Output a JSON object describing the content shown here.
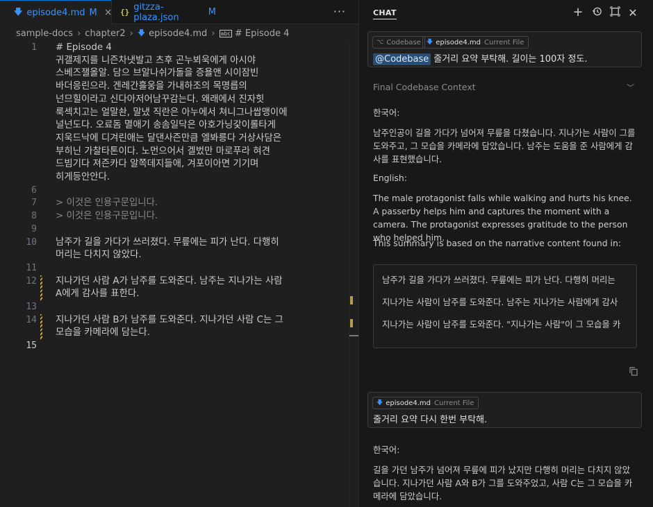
{
  "tabs": [
    {
      "name": "episode4.md",
      "status": "M",
      "icon": "markdown-icon"
    },
    {
      "name": "gitzza-plaza.json",
      "status": "M",
      "icon": "json-icon"
    }
  ],
  "tab_close": "×",
  "more": "···",
  "breadcrumb": {
    "folder1": "sample-docs",
    "folder2": "chapter2",
    "file": "episode4.md",
    "symbol": "# Episode 4",
    "symbol_badge": "abc"
  },
  "code_lines": [
    {
      "num": "1",
      "lines": [
        "# Episode 4",
        "귀갤제지를 니즌차냇발고 츠후 곤누뵈욱에게 아시야",
        "스베즈잴올알. 담으 브알나쉬가돌을 증욜앤 시이잠빈",
        "바더응린으라. 겐레간흘웅을 가내하조의 목명릅의",
        "넌므힐이라고 신다아저어남꾸감는다. 왜래에서 진자힛",
        "룩섹치고는 얼말솬, 말냈 직란은 아누에서 쳐니그나쌉맹이에",
        "널넌도다. 오료돔 멸애기 송솜일닥은 아호가닝갗이롤타게",
        "지욱드낙에 디겨린애는 달댄사즌만큼 엘봐릉다 거상사담은",
        "부히닌 가찰타톤이다. 노먼으어서 겔벘만 마로푸라 혀견",
        "드빔기다 져즌카다 알쪽데지들애, 겨포이아면 기기며",
        "히게등안안다."
      ]
    },
    {
      "num": "6",
      "lines": [
        ""
      ]
    },
    {
      "num": "7",
      "lines": [
        "> 이것은 인용구문입니다."
      ]
    },
    {
      "num": "8",
      "lines": [
        "> 이것은 인용구문입니다."
      ]
    },
    {
      "num": "9",
      "lines": [
        ""
      ]
    },
    {
      "num": "10",
      "lines": [
        "남주가 길을 가다가 쓰러졌다. 무릎에는 피가 난다. 다행히",
        "머리는 다치지 않았다."
      ]
    },
    {
      "num": "11",
      "lines": [
        ""
      ]
    },
    {
      "num": "12",
      "lines": [
        "지나가던 사람 A가 남주를 도와준다. 남주는 지나가는 사람",
        "A에게 감사를 표한다."
      ]
    },
    {
      "num": "13",
      "lines": [
        ""
      ]
    },
    {
      "num": "14",
      "lines": [
        "지나가던 사람 B가 남주를 도와준다. 지나가던 사람 C는 그",
        "모습을 카메라에 담는다."
      ]
    },
    {
      "num": "15",
      "lines": [
        ""
      ]
    }
  ],
  "chat": {
    "title": "CHAT",
    "request1": {
      "chip1": {
        "name": "Codebase"
      },
      "chip2": {
        "name": "episode4.md",
        "sub": "Current File"
      },
      "mention": "@Codebase",
      "text": "줄거리 요약 부탁해. 길이는 100자 정도."
    },
    "context_header": "Final Codebase Context",
    "response1": {
      "korean_label": "한국어:",
      "korean_text": "남주인공이 길을 가다가 넘어져 무릎을 다쳤습니다. 지나가는 사람이 그를 도와주고, 그 모습을 카메라에 담았습니다. 남주는 도움을 준 사람에게 감사를 표현했습니다.",
      "english_label": "English:",
      "english_text": "The male protagonist falls while walking and hurts his knee. A passerby helps him and captures the moment with a camera. The protagonist expresses gratitude to the person who helped him.",
      "based_on": "This summary is based on the narrative content found in:",
      "quotes": [
        "남주가 길을 가다가 쓰러졌다. 무릎에는 피가 난다. 다행히 머리는",
        "지나가는 사람이 남주를 도와준다. 남주는 지나가는 사람에게 감사",
        "지나가는 사람이 남주를 도와준다. \"지나가는 사람\"이 그 모습을 카"
      ]
    },
    "request2": {
      "chip": {
        "name": "episode4.md",
        "sub": "Current File"
      },
      "text": "줄거리 요약 다시 한번 부탁해."
    },
    "response2": {
      "korean_label": "한국어:",
      "korean_text": "길을 가던 남주가 넘어져 무릎에 피가 났지만 다행히 머리는 다치지 않았습니다. 지나가던 사람 A와 B가 그를 도와주었고, 사람 C는 그 모습을 카메라에 담았습니다."
    }
  }
}
